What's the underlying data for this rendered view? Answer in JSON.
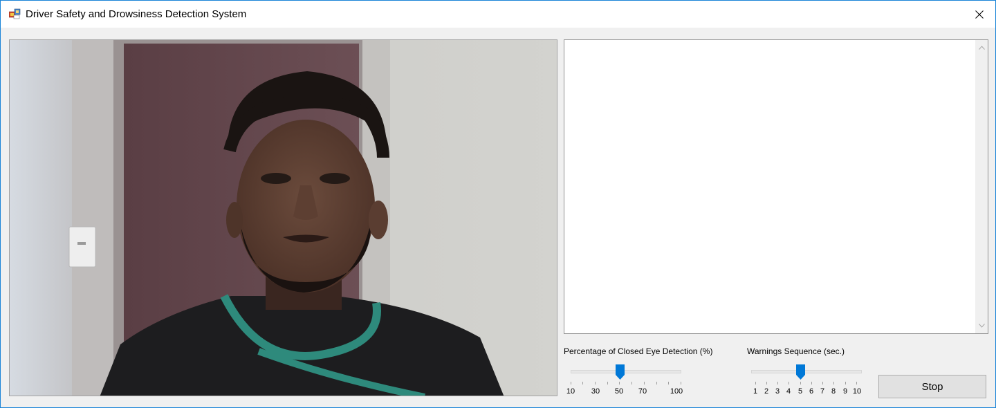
{
  "window": {
    "title": "Driver Safety and Drowsiness Detection System",
    "close_icon": "close-icon"
  },
  "log": {
    "content": ""
  },
  "closed_eye_slider": {
    "label": "Percentage of Closed Eye Detection (%)",
    "tick_labels": [
      "10",
      "30",
      "50",
      "70",
      "100"
    ],
    "value": 50,
    "min": 10,
    "max": 100
  },
  "warnings_slider": {
    "label": "Warnings Sequence (sec.)",
    "tick_labels": [
      "1",
      "2",
      "3",
      "4",
      "5",
      "6",
      "7",
      "8",
      "9",
      "10"
    ],
    "value": 5,
    "min": 1,
    "max": 10
  },
  "stop_button": {
    "label": "Stop"
  },
  "colors": {
    "accent": "#0078d7",
    "window_border": "#1883d7"
  }
}
